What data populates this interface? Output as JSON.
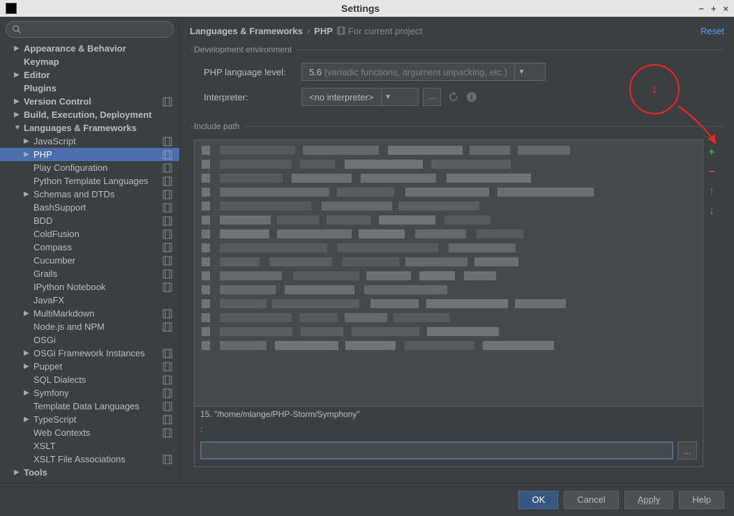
{
  "window": {
    "title": "Settings",
    "min": "−",
    "max": "+",
    "close": "×"
  },
  "search": {
    "placeholder": ""
  },
  "tree": [
    {
      "label": "Appearance & Behavior",
      "indent": 1,
      "arrow": "collapsed",
      "bold": true
    },
    {
      "label": "Keymap",
      "indent": 1,
      "arrow": "none",
      "bold": true
    },
    {
      "label": "Editor",
      "indent": 1,
      "arrow": "collapsed",
      "bold": true
    },
    {
      "label": "Plugins",
      "indent": 1,
      "arrow": "none",
      "bold": true
    },
    {
      "label": "Version Control",
      "indent": 1,
      "arrow": "collapsed",
      "bold": true,
      "badge": true
    },
    {
      "label": "Build, Execution, Deployment",
      "indent": 1,
      "arrow": "collapsed",
      "bold": true
    },
    {
      "label": "Languages & Frameworks",
      "indent": 1,
      "arrow": "expanded",
      "bold": true
    },
    {
      "label": "JavaScript",
      "indent": 2,
      "arrow": "collapsed",
      "badge": true
    },
    {
      "label": "PHP",
      "indent": 2,
      "arrow": "collapsed",
      "selected": true,
      "badge": true
    },
    {
      "label": "Play Configuration",
      "indent": 2,
      "arrow": "none",
      "badge": true
    },
    {
      "label": "Python Template Languages",
      "indent": 2,
      "arrow": "none",
      "badge": true
    },
    {
      "label": "Schemas and DTDs",
      "indent": 2,
      "arrow": "collapsed",
      "badge": true
    },
    {
      "label": "BashSupport",
      "indent": 2,
      "arrow": "none",
      "badge": true
    },
    {
      "label": "BDD",
      "indent": 2,
      "arrow": "none",
      "badge": true
    },
    {
      "label": "ColdFusion",
      "indent": 2,
      "arrow": "none",
      "badge": true
    },
    {
      "label": "Compass",
      "indent": 2,
      "arrow": "none",
      "badge": true
    },
    {
      "label": "Cucumber",
      "indent": 2,
      "arrow": "none",
      "badge": true
    },
    {
      "label": "Grails",
      "indent": 2,
      "arrow": "none",
      "badge": true
    },
    {
      "label": "IPython Notebook",
      "indent": 2,
      "arrow": "none",
      "badge": true
    },
    {
      "label": "JavaFX",
      "indent": 2,
      "arrow": "none"
    },
    {
      "label": "MultiMarkdown",
      "indent": 2,
      "arrow": "collapsed",
      "badge": true
    },
    {
      "label": "Node.js and NPM",
      "indent": 2,
      "arrow": "none",
      "badge": true
    },
    {
      "label": "OSGi",
      "indent": 2,
      "arrow": "none"
    },
    {
      "label": "OSGi Framework Instances",
      "indent": 2,
      "arrow": "collapsed",
      "badge": true
    },
    {
      "label": "Puppet",
      "indent": 2,
      "arrow": "collapsed",
      "badge": true
    },
    {
      "label": "SQL Dialects",
      "indent": 2,
      "arrow": "none",
      "badge": true
    },
    {
      "label": "Symfony",
      "indent": 2,
      "arrow": "collapsed",
      "badge": true
    },
    {
      "label": "Template Data Languages",
      "indent": 2,
      "arrow": "none",
      "badge": true
    },
    {
      "label": "TypeScript",
      "indent": 2,
      "arrow": "collapsed",
      "badge": true
    },
    {
      "label": "Web Contexts",
      "indent": 2,
      "arrow": "none",
      "badge": true
    },
    {
      "label": "XSLT",
      "indent": 2,
      "arrow": "none"
    },
    {
      "label": "XSLT File Associations",
      "indent": 2,
      "arrow": "none",
      "badge": true
    },
    {
      "label": "Tools",
      "indent": 1,
      "arrow": "collapsed",
      "bold": true
    }
  ],
  "breadcrumb": {
    "root": "Languages & Frameworks",
    "sep": "›",
    "leaf": "PHP",
    "note": "For current project",
    "reset": "Reset"
  },
  "dev_env": {
    "legend": "Development environment",
    "lang_label": "PHP language level:",
    "lang_value": "5.6",
    "lang_hint": "(variadic functions, argument unpacking, etc.)",
    "interp_label": "Interpreter:",
    "interp_value": "<no interpreter>",
    "browse": "..."
  },
  "include": {
    "legend": "Include path",
    "visible_row": "15.  \"/home/mlange/PHP-Storm/Symphony\"",
    "colon_row": ":",
    "browse": "..."
  },
  "toolbar": {
    "add": "+",
    "remove": "−",
    "up": "↑",
    "down": "↓"
  },
  "footer": {
    "ok": "OK",
    "cancel": "Cancel",
    "apply": "Apply",
    "help": "Help"
  },
  "annotation": {
    "num": "1"
  }
}
